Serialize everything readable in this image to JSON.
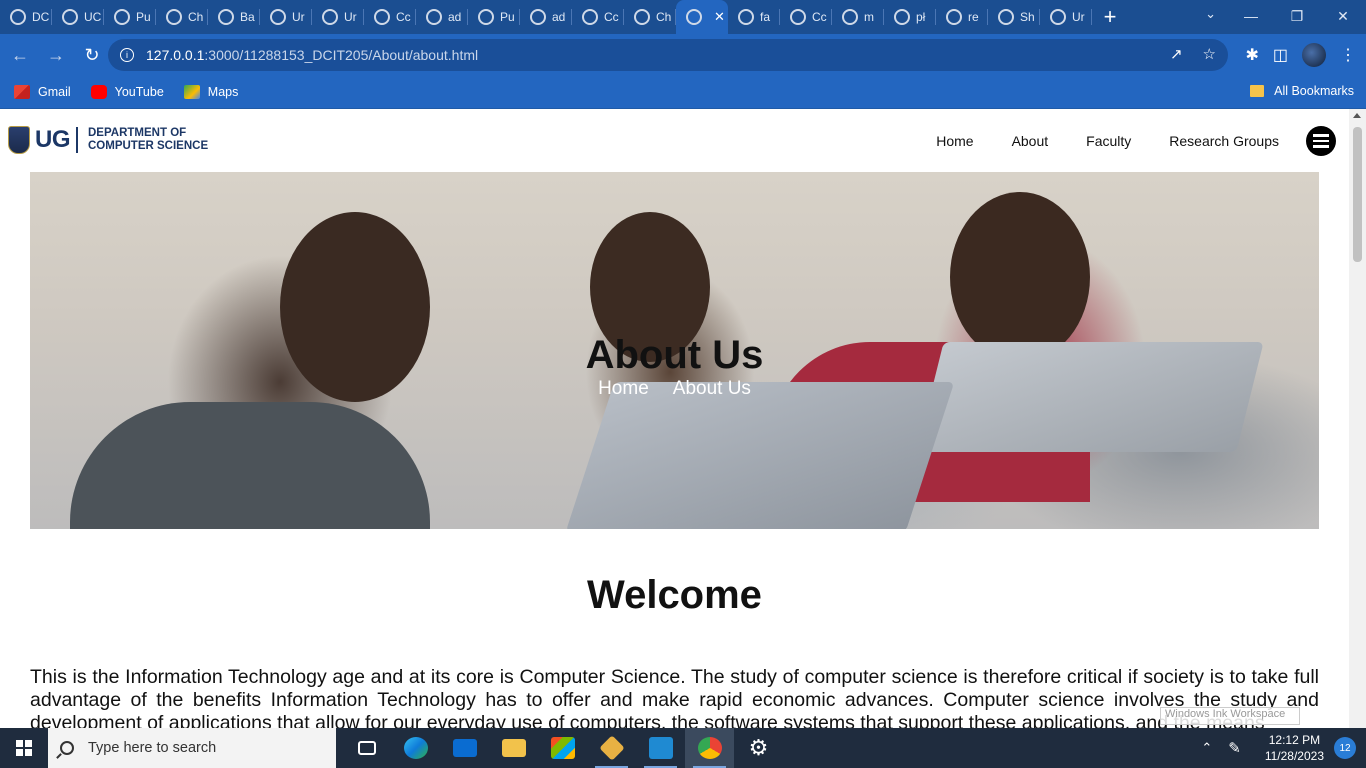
{
  "browser": {
    "tabs": [
      {
        "label": "DC"
      },
      {
        "label": "UC"
      },
      {
        "label": "Pu"
      },
      {
        "label": "Ch"
      },
      {
        "label": "Ba"
      },
      {
        "label": "Ur"
      },
      {
        "label": "Ur"
      },
      {
        "label": "Cc"
      },
      {
        "label": "ad"
      },
      {
        "label": "Pu"
      },
      {
        "label": "ad"
      },
      {
        "label": "Cc"
      },
      {
        "label": "Ch"
      },
      {
        "label": ""
      },
      {
        "label": "fa"
      },
      {
        "label": "Cc"
      },
      {
        "label": "m"
      },
      {
        "label": "pł"
      },
      {
        "label": "re"
      },
      {
        "label": "Sh"
      },
      {
        "label": "Ur"
      }
    ],
    "active_tab_index": 13,
    "url_host": "127.0.0.1",
    "url_path": ":3000/11288153_DCIT205/About/about.html",
    "bookmarks": [
      {
        "label": "Gmail"
      },
      {
        "label": "YouTube"
      },
      {
        "label": "Maps"
      }
    ],
    "all_bookmarks_label": "All Bookmarks"
  },
  "site": {
    "logo_ug": "UG",
    "logo_line1": "DEPARTMENT OF",
    "logo_line2": "COMPUTER SCIENCE",
    "nav": [
      {
        "label": "Home"
      },
      {
        "label": "About"
      },
      {
        "label": "Faculty"
      },
      {
        "label": "Research Groups"
      }
    ],
    "hero_title": "About Us",
    "breadcrumb": {
      "home": "Home",
      "current": "About Us"
    },
    "welcome_heading": "Welcome",
    "intro_text": "This is the Information Technology age and at its core is Computer Science. The study of computer science is therefore critical if society is to take full advantage of the benefits Information Technology has to offer and make rapid economic advances. Computer science involves the study and development of applications that allow for our everyday use of computers, the software systems that support these applications, and the means"
  },
  "watermark": "Windows Ink Workspace",
  "taskbar": {
    "search_placeholder": "Type here to search",
    "time": "12:12 PM",
    "date": "11/28/2023",
    "notifications": "12"
  },
  "colors": {
    "chrome_frame": "#1b4e91",
    "chrome_toolbar": "#2366c0",
    "ug_blue": "#1c3766",
    "taskbar": "#1f2c3e"
  }
}
